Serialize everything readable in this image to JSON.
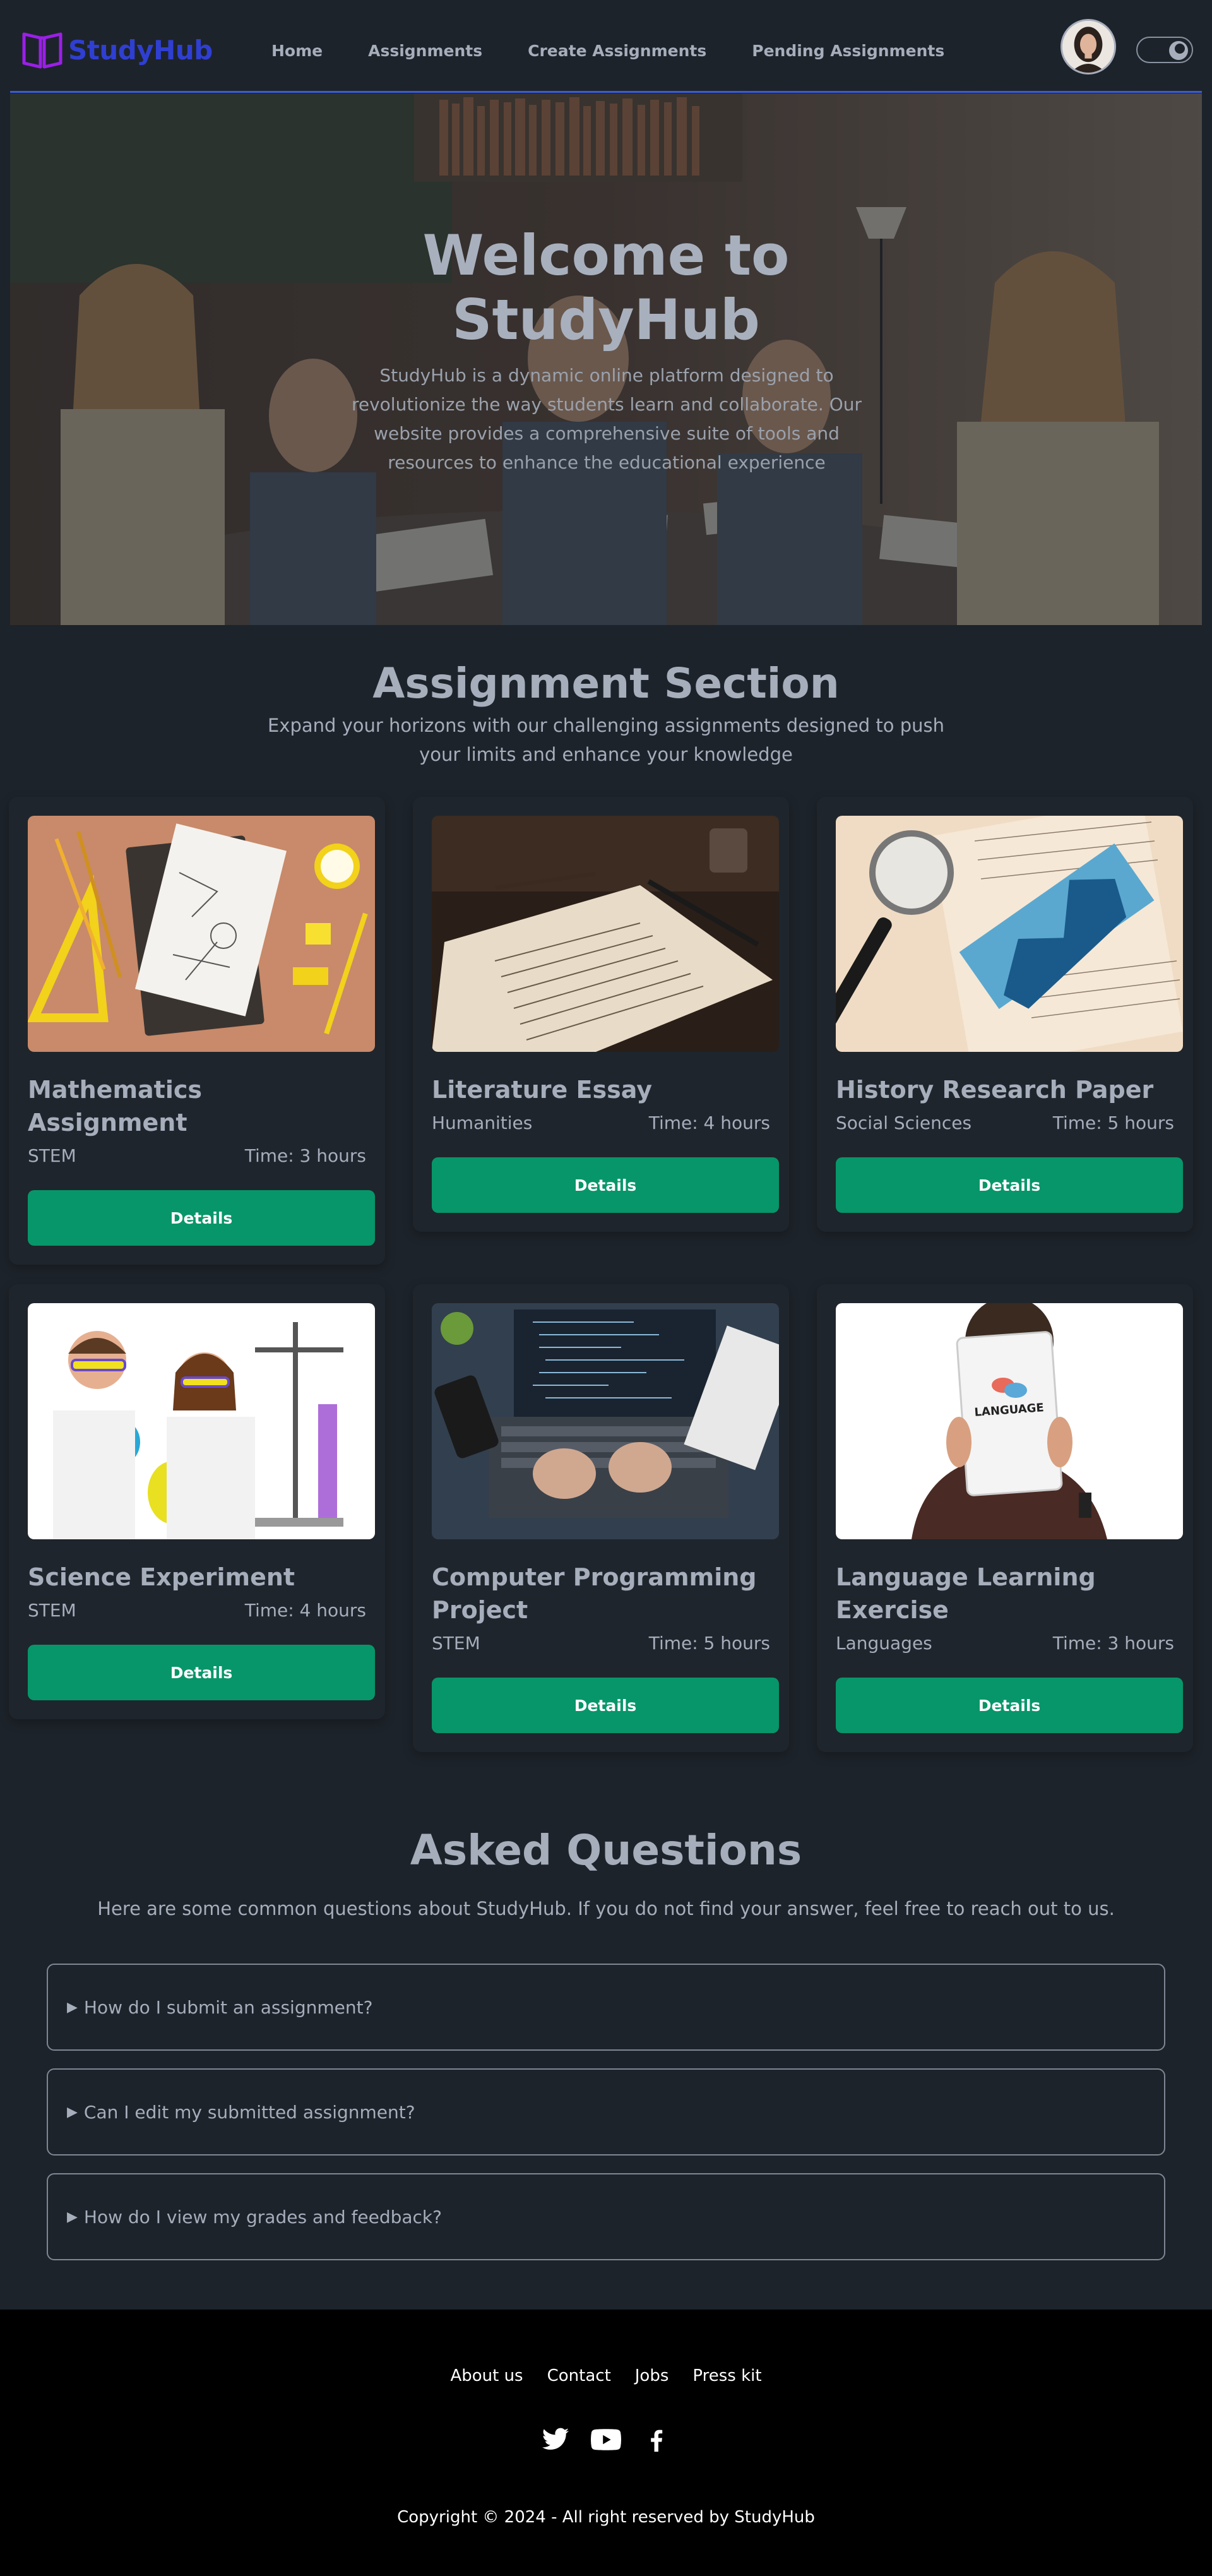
{
  "brand": {
    "name": "StudyHub",
    "logo_color": "#9b1fe8",
    "text_color": "#2f3fd1"
  },
  "nav": {
    "items": [
      {
        "label": "Home"
      },
      {
        "label": "Assignments"
      },
      {
        "label": "Create Assignments"
      },
      {
        "label": "Pending Assignments"
      }
    ],
    "avatar_icon": "user-avatar",
    "theme_toggle_icon": "moon-icon"
  },
  "hero": {
    "title_line1": "Welcome to",
    "title_line2": "StudyHub",
    "subtitle": "StudyHub is a dynamic online platform designed to revolutionize the way students learn and collaborate. Our website provides a comprehensive suite of tools and resources to enhance the educational experience"
  },
  "assignments": {
    "title": "Assignment Section",
    "subtitle": "Expand your horizons with our challenging assignments designed to push your limits and enhance your knowledge",
    "cards": [
      {
        "title": "Mathematics Assignment",
        "category": "STEM",
        "time": "Time: 3 hours",
        "button": "Details"
      },
      {
        "title": "Literature Essay",
        "category": "Humanities",
        "time": "Time: 4 hours",
        "button": "Details"
      },
      {
        "title": "History Research Paper",
        "category": "Social Sciences",
        "time": "Time: 5 hours",
        "button": "Details"
      },
      {
        "title": "Science Experiment",
        "category": "STEM",
        "time": "Time: 4 hours",
        "button": "Details"
      },
      {
        "title": "Computer Programming Project",
        "category": "STEM",
        "time": "Time: 5 hours",
        "button": "Details"
      },
      {
        "title": "Language Learning Exercise",
        "category": "Languages",
        "time": "Time: 3 hours",
        "button": "Details",
        "image_text": "LANGUAGE"
      }
    ]
  },
  "faq": {
    "title": "Asked Questions",
    "subtitle": "Here are some common questions about StudyHub. If you do not find your answer, feel free to reach out to us.",
    "items": [
      {
        "question": "How do I submit an assignment?"
      },
      {
        "question": "Can I edit my submitted assignment?"
      },
      {
        "question": "How do I view my grades and feedback?"
      }
    ]
  },
  "footer": {
    "links": [
      {
        "label": "About us"
      },
      {
        "label": "Contact"
      },
      {
        "label": "Jobs"
      },
      {
        "label": "Press kit"
      }
    ],
    "social": [
      "twitter-icon",
      "youtube-icon",
      "facebook-icon"
    ],
    "copyright": "Copyright © 2024 - All right reserved by StudyHub"
  },
  "colors": {
    "background": "#1d232a",
    "accent_button": "#079669",
    "nav_underline": "#3b5bdb",
    "footer_bg": "#000000"
  }
}
